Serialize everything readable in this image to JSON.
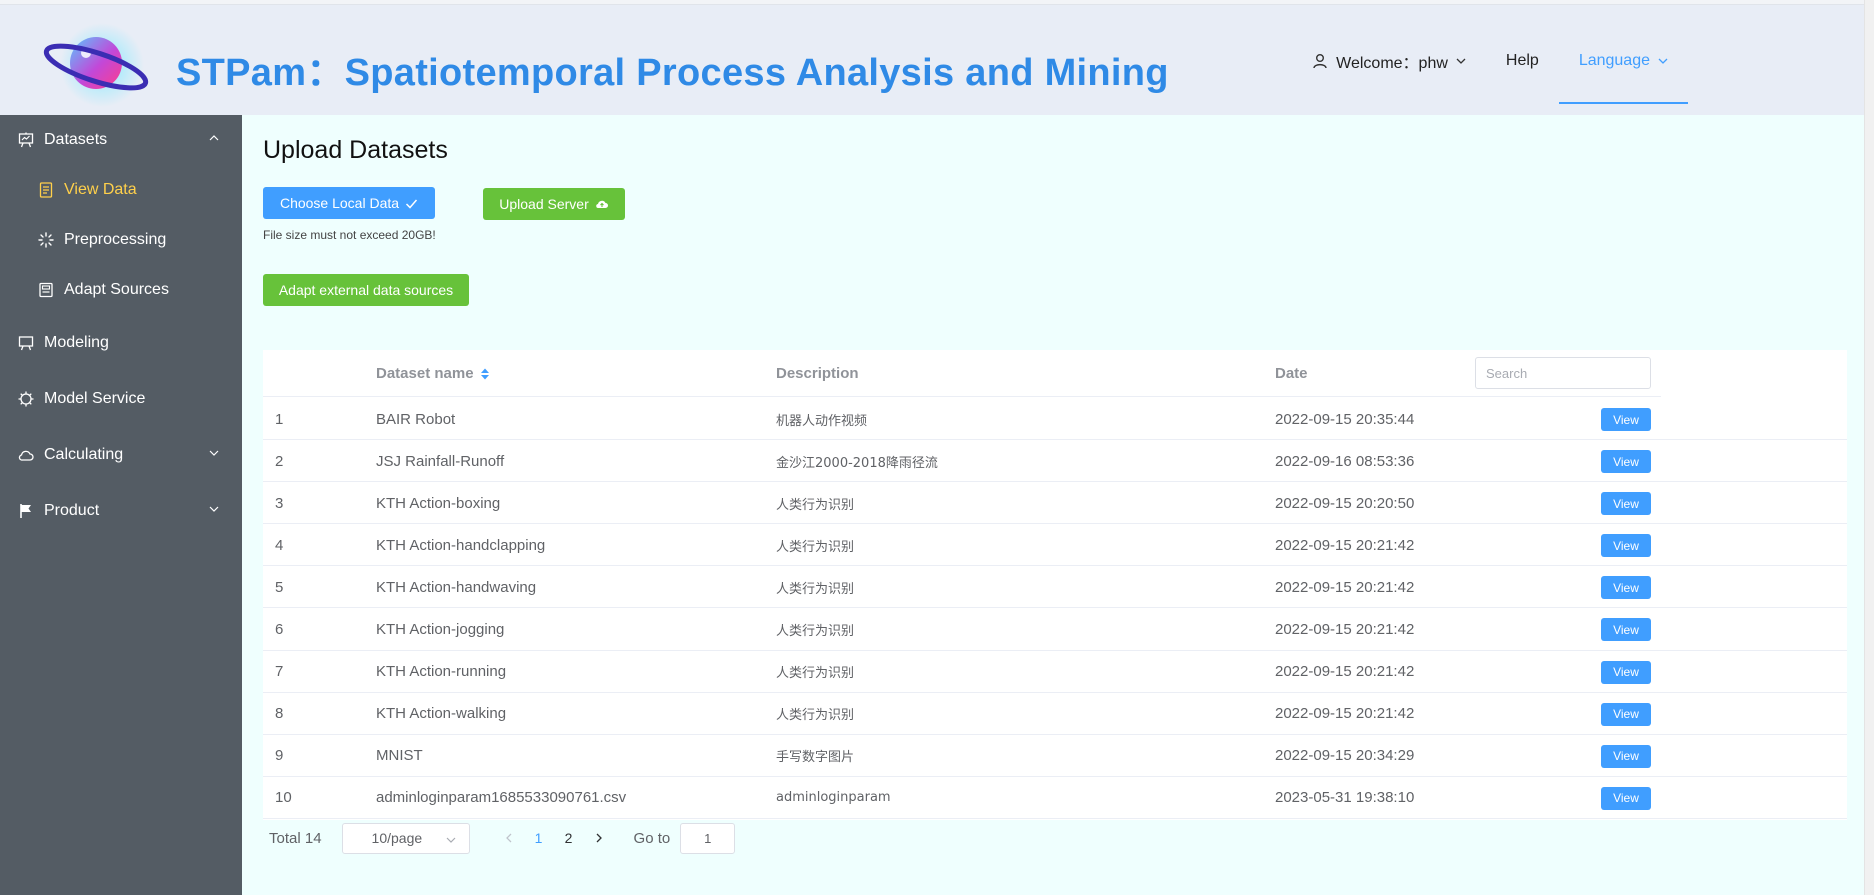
{
  "colors": {
    "brand": "#2f8ae6",
    "primary": "#409eff",
    "success": "#67c23a",
    "sidebar_bg": "#545c64",
    "sidebar_active": "#ffd04b"
  },
  "header": {
    "title": "STPam：Spatiotemporal Process Analysis and Mining",
    "welcome": "Welcome：phw",
    "help": "Help",
    "language": "Language"
  },
  "sidebar": {
    "datasets": {
      "label": "Datasets",
      "icon": "easel-icon",
      "expanded": true
    },
    "sub": [
      {
        "label": "View Data",
        "icon": "document-icon",
        "active": true
      },
      {
        "label": "Preprocessing",
        "icon": "loading-icon"
      },
      {
        "label": "Adapt Sources",
        "icon": "tickets-icon"
      }
    ],
    "modeling": {
      "label": "Modeling",
      "icon": "monitor-icon"
    },
    "model_service": {
      "label": "Model Service",
      "icon": "cpu-icon"
    },
    "calculating": {
      "label": "Calculating",
      "icon": "cloud-icon"
    },
    "product": {
      "label": "Product",
      "icon": "flag-icon"
    }
  },
  "main": {
    "title": "Upload Datasets",
    "choose_local": "Choose Local Data",
    "upload_server": "Upload Server",
    "size_hint": "File size must not exceed 20GB!",
    "adapt_external": "Adapt external data sources"
  },
  "table": {
    "columns": {
      "name": "Dataset name",
      "description": "Description",
      "date": "Date"
    },
    "search_placeholder": "Search",
    "view_label": "View",
    "rows": [
      {
        "idx": "1",
        "name": "BAIR Robot",
        "description": "机器人动作视频",
        "date": "2022-09-15 20:35:44"
      },
      {
        "idx": "2",
        "name": "JSJ Rainfall-Runoff",
        "description": "金沙江2000-2018降雨径流",
        "date": "2022-09-16 08:53:36"
      },
      {
        "idx": "3",
        "name": "KTH Action-boxing",
        "description": "人类行为识别",
        "date": "2022-09-15 20:20:50"
      },
      {
        "idx": "4",
        "name": "KTH Action-handclapping",
        "description": "人类行为识别",
        "date": "2022-09-15 20:21:42"
      },
      {
        "idx": "5",
        "name": "KTH Action-handwaving",
        "description": "人类行为识别",
        "date": "2022-09-15 20:21:42"
      },
      {
        "idx": "6",
        "name": "KTH Action-jogging",
        "description": "人类行为识别",
        "date": "2022-09-15 20:21:42"
      },
      {
        "idx": "7",
        "name": "KTH Action-running",
        "description": "人类行为识别",
        "date": "2022-09-15 20:21:42"
      },
      {
        "idx": "8",
        "name": "KTH Action-walking",
        "description": "人类行为识别",
        "date": "2022-09-15 20:21:42"
      },
      {
        "idx": "9",
        "name": "MNIST",
        "description": "手写数字图片",
        "date": "2022-09-15 20:34:29"
      },
      {
        "idx": "10",
        "name": "adminloginparam1685533090761.csv",
        "description": "adminloginparam",
        "date": "2023-05-31 19:38:10"
      }
    ]
  },
  "pagination": {
    "total": "Total 14",
    "page_size": "10/page",
    "pages": [
      "1",
      "2"
    ],
    "current_page": "1",
    "goto_label": "Go to",
    "goto_value": "1"
  }
}
